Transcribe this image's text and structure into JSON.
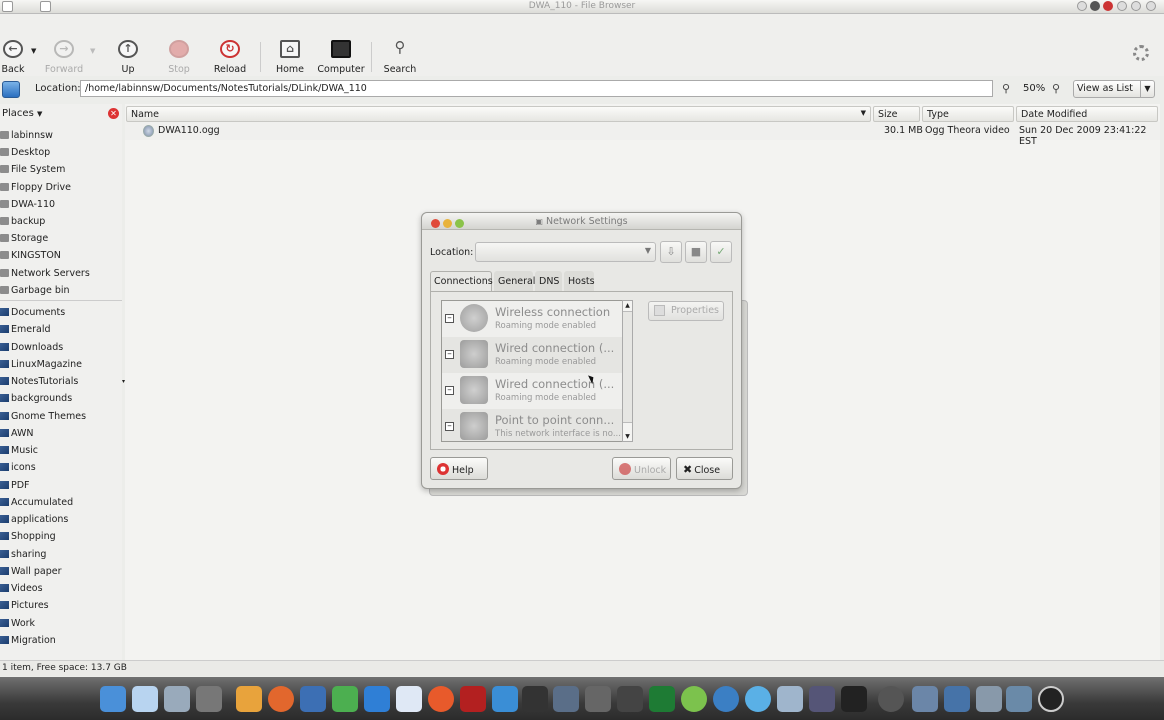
{
  "window": {
    "title": "DWA_110 - File Browser"
  },
  "toolbar": {
    "back": "Back",
    "forward": "Forward",
    "up": "Up",
    "stop": "Stop",
    "reload": "Reload",
    "home": "Home",
    "computer": "Computer",
    "search": "Search"
  },
  "location": {
    "label": "Location:",
    "path": "/home/labinnsw/Documents/NotesTutorials/DLink/DWA_110",
    "zoom": "50%",
    "view": "View as List"
  },
  "sidebar": {
    "header": "Places",
    "devices": [
      "labinnsw",
      "Desktop",
      "File System",
      "Floppy Drive",
      "DWA-110",
      "backup",
      "Storage",
      "KINGSTON",
      "Network Servers",
      "Garbage bin"
    ],
    "bookmarks": [
      "Documents",
      "Emerald",
      "Downloads",
      "LinuxMagazine",
      "NotesTutorials",
      "backgrounds",
      "Gnome Themes",
      "AWN",
      "Music",
      "icons",
      "PDF",
      "Accumulated",
      "applications",
      "Shopping",
      "sharing",
      "Wall paper",
      "Videos",
      "Pictures",
      "Work",
      "Migration"
    ]
  },
  "columns": {
    "name": "Name",
    "size": "Size",
    "type": "Type",
    "date": "Date Modified"
  },
  "files": [
    {
      "name": "DWA110.ogg",
      "size": "30.1 MB",
      "type": "Ogg Theora video",
      "date": "Sun 20 Dec 2009 23:41:22 EST"
    }
  ],
  "status": "1 item, Free space: 13.7 GB",
  "dialog": {
    "title": "Network Settings",
    "location_label": "Location:",
    "tabs": [
      "Connections",
      "General",
      "DNS",
      "Hosts"
    ],
    "connections": [
      {
        "name": "Wireless connection",
        "status": "Roaming mode enabled"
      },
      {
        "name": "Wired connection (...",
        "status": "Roaming mode enabled"
      },
      {
        "name": "Wired connection (...",
        "status": "Roaming mode enabled"
      },
      {
        "name": "Point to point conn...",
        "status": "This network interface is no..."
      }
    ],
    "properties": "Properties",
    "help": "Help",
    "unlock": "Unlock",
    "close": "Close"
  }
}
